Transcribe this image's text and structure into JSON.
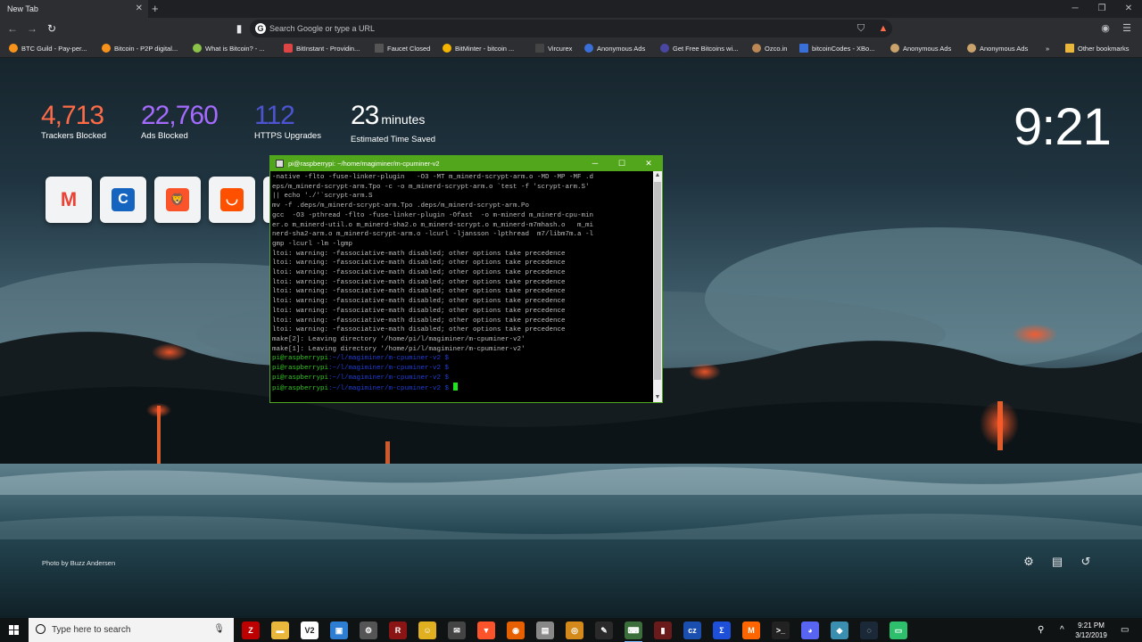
{
  "browser": {
    "tab_title": "New Tab",
    "tab_close": "✕",
    "new_tab": "+",
    "omnibox_placeholder": "Search Google or type a URL",
    "bookmarks": [
      {
        "label": "BTC Guild - Pay-per...",
        "color": "#f7931a"
      },
      {
        "label": "Bitcoin - P2P digital...",
        "color": "#f7931a"
      },
      {
        "label": "What is Bitcoin? - ...",
        "color": "#8bc34a"
      },
      {
        "label": "BitInstant - Providin...",
        "color": "#d44"
      },
      {
        "label": "Faucet Closed",
        "color": "#555"
      },
      {
        "label": "BitMinter - bitcoin ...",
        "color": "#f5b400"
      },
      {
        "label": "Vircurex",
        "color": "#444"
      },
      {
        "label": "Anonymous Ads",
        "color": "#3a6fd8"
      },
      {
        "label": "Get Free Bitcoins wi...",
        "color": "#4a47a3"
      },
      {
        "label": "Ozco.in",
        "color": "#b85"
      },
      {
        "label": "bitcoinCodes - XBo...",
        "color": "#3a6fd8"
      },
      {
        "label": "Anonymous Ads",
        "color": "#c9a36b"
      },
      {
        "label": "Anonymous Ads",
        "color": "#c9a36b"
      }
    ],
    "bookmarks_more": "»",
    "other_bookmarks": "Other bookmarks"
  },
  "stats": [
    {
      "value": "4,713",
      "label": "Trackers Blocked",
      "color": "#ff6b47"
    },
    {
      "value": "22,760",
      "label": "Ads Blocked",
      "color": "#a56bff"
    },
    {
      "value": "112",
      "label": "HTTPS Upgrades",
      "color": "#4c54d2"
    },
    {
      "value": "23",
      "unit": "minutes",
      "label": "Estimated Time Saved",
      "color": "#ffffff"
    }
  ],
  "clock": "9:21",
  "tiles": [
    {
      "icon": "gmail-icon",
      "glyph": "M",
      "color": "#ea4335",
      "bg": "#f1f3f4"
    },
    {
      "icon": "coinmarketcap-icon",
      "glyph": "C",
      "color": "#ffffff",
      "bg": "#1565c0"
    },
    {
      "icon": "brave-icon",
      "glyph": "🦁",
      "color": "#ffffff",
      "bg": "#fb542b"
    },
    {
      "icon": "shopping-bag-icon",
      "glyph": "◡",
      "color": "#ffffff",
      "bg": "#ff5000"
    }
  ],
  "photo_credit": "Photo by Buzz Andersen",
  "terminal": {
    "title": "pi@raspberrypi: ~/home/magiminer/m-cpuminer-v2",
    "lines": [
      "-native -flto -fuse-linker-plugin   -O3 -MT m_minerd-scrypt-arm.o -MD -MP -MF .d",
      "eps/m_minerd-scrypt-arm.Tpo -c -o m_minerd-scrypt-arm.o `test -f 'scrypt-arm.S'",
      "|| echo './'`scrypt-arm.S",
      "mv -f .deps/m_minerd-scrypt-arm.Tpo .deps/m_minerd-scrypt-arm.Po",
      "gcc  -O3 -pthread -flto -fuse-linker-plugin -Ofast  -o m-minerd m_minerd-cpu-min",
      "er.o m_minerd-util.o m_minerd-sha2.o m_minerd-scrypt.o m_minerd-m7mhash.o   m_mi",
      "nerd-sha2-arm.o m_minerd-scrypt-arm.o -lcurl -ljansson -lpthread  m7/libm7m.a -l",
      "gmp -lcurl -lm -lgmp",
      "ltoi: warning: -fassociative-math disabled; other options take precedence",
      "ltoi: warning: -fassociative-math disabled; other options take precedence",
      "ltoi: warning: -fassociative-math disabled; other options take precedence",
      "ltoi: warning: -fassociative-math disabled; other options take precedence",
      "ltoi: warning: -fassociative-math disabled; other options take precedence",
      "ltoi: warning: -fassociative-math disabled; other options take precedence",
      "ltoi: warning: -fassociative-math disabled; other options take precedence",
      "ltoi: warning: -fassociative-math disabled; other options take precedence",
      "ltoi: warning: -fassociative-math disabled; other options take precedence",
      "make[2]: Leaving directory '/home/pi/l/magiminer/m-cpuminer-v2'",
      "make[1]: Leaving directory '/home/pi/l/magiminer/m-cpuminer-v2'"
    ],
    "prompt_user": "pi@raspberrypi",
    "prompt_path": ":~/l/magiminer/m-cpuminer-v2 $",
    "prompt_count": 4
  },
  "taskbar": {
    "search_placeholder": "Type here to search",
    "apps": [
      {
        "icon": "filezilla-icon",
        "glyph": "Z",
        "bg": "#bf0000"
      },
      {
        "icon": "file-explorer-icon",
        "glyph": "▬",
        "bg": "#e8b73c"
      },
      {
        "icon": "vnc-viewer-icon",
        "glyph": "V2",
        "bg": "#ffffff"
      },
      {
        "icon": "photos-icon",
        "glyph": "▣",
        "bg": "#2d7dd2"
      },
      {
        "icon": "raspberry-icon",
        "glyph": "⚙",
        "bg": "#555555"
      },
      {
        "icon": "r-app-icon",
        "glyph": "R",
        "bg": "#8b1414"
      },
      {
        "icon": "emoji-app-icon",
        "glyph": "☺",
        "bg": "#e0b020"
      },
      {
        "icon": "mail-icon",
        "glyph": "✉",
        "bg": "#444444"
      },
      {
        "icon": "brave-taskbar-icon",
        "glyph": "▼",
        "bg": "#fb542b"
      },
      {
        "icon": "firefox-icon",
        "glyph": "◉",
        "bg": "#e66000"
      },
      {
        "icon": "notes-icon",
        "glyph": "▤",
        "bg": "#888888"
      },
      {
        "icon": "bitcoin-wallet-icon",
        "glyph": "◎",
        "bg": "#d38a1a"
      },
      {
        "icon": "pen-icon",
        "glyph": "✎",
        "bg": "#2a2a2a"
      },
      {
        "icon": "putty-icon",
        "glyph": "⌨",
        "bg": "#3c6e3c"
      },
      {
        "icon": "wallet-red-icon",
        "glyph": "▮",
        "bg": "#6a1a1a"
      },
      {
        "icon": "cz-icon",
        "glyph": "cz",
        "bg": "#1a4fb0"
      },
      {
        "icon": "sigma-icon",
        "glyph": "Σ",
        "bg": "#1e4fd8"
      },
      {
        "icon": "monero-icon",
        "glyph": "M",
        "bg": "#ff6600"
      },
      {
        "icon": "terminal-icon",
        "glyph": ">_",
        "bg": "#222222"
      },
      {
        "icon": "discord-icon",
        "glyph": "◕",
        "bg": "#5865f2"
      },
      {
        "icon": "wallet-blue-icon",
        "glyph": "◆",
        "bg": "#3a8fb0"
      },
      {
        "icon": "steam-icon",
        "glyph": "◌",
        "bg": "#1b2838"
      },
      {
        "icon": "chat-green-icon",
        "glyph": "▭",
        "bg": "#2dbf6c"
      }
    ],
    "tray_time": "9:21 PM",
    "tray_date": "3/12/2019"
  }
}
